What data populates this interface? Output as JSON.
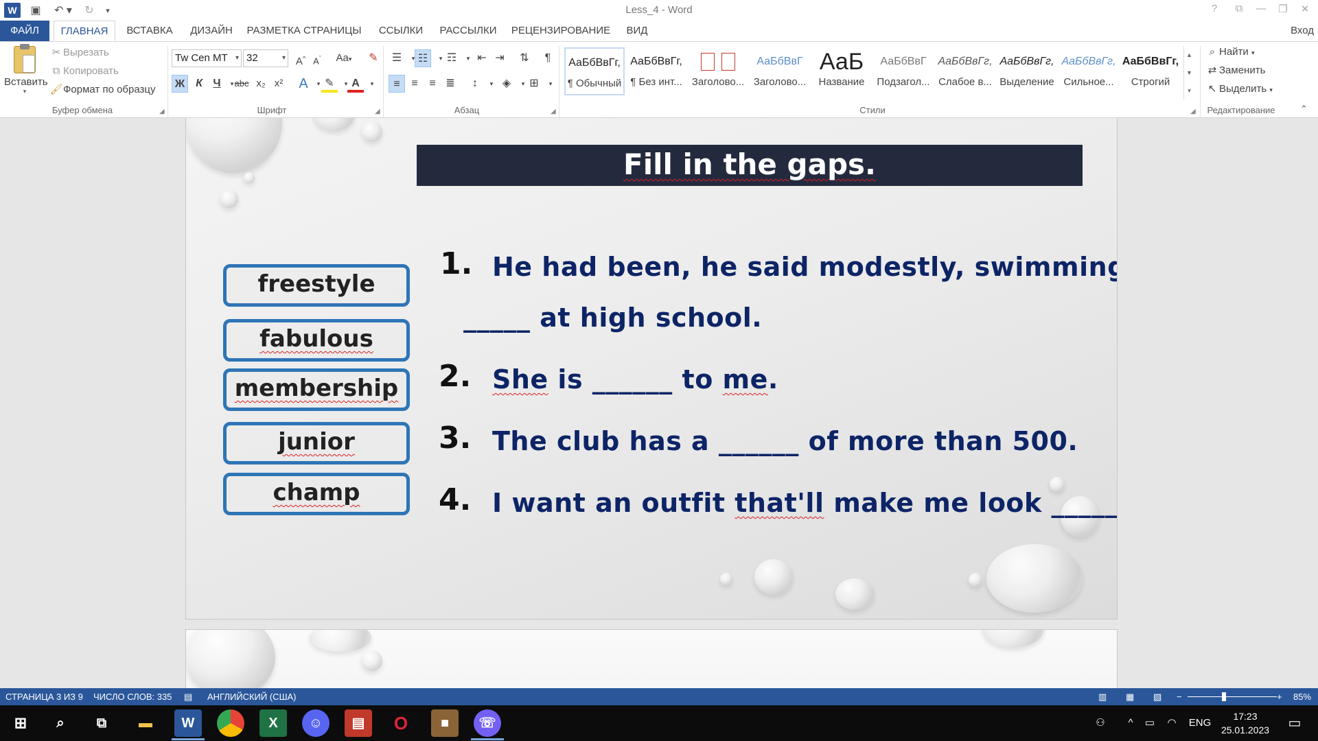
{
  "app": {
    "window_title": "Less_4 - Word",
    "sign_in": "Вход"
  },
  "tabs": [
    {
      "label": "ФАЙЛ"
    },
    {
      "label": "ГЛАВНАЯ"
    },
    {
      "label": "ВСТАВКА"
    },
    {
      "label": "ДИЗАЙН"
    },
    {
      "label": "РАЗМЕТКА СТРАНИЦЫ"
    },
    {
      "label": "ССЫЛКИ"
    },
    {
      "label": "РАССЫЛКИ"
    },
    {
      "label": "РЕЦЕНЗИРОВАНИЕ"
    },
    {
      "label": "ВИД"
    }
  ],
  "ribbon": {
    "clipboard": {
      "paste": "Вставить",
      "cut": "Вырезать",
      "copy": "Копировать",
      "format_painter": "Формат по образцу",
      "group_label": "Буфер обмена"
    },
    "font": {
      "font_name": "Tw Cen MT",
      "font_size": "32",
      "group_label": "Шрифт",
      "bold": "Ж",
      "italic": "К",
      "underline": "Ч",
      "strike": "abc",
      "subscript": "x₂",
      "superscript": "x²",
      "grow": "A",
      "shrink": "A",
      "case": "Aa"
    },
    "paragraph": {
      "group_label": "Абзац"
    },
    "styles": {
      "group_label": "Стили",
      "items": [
        {
          "sample": "АаБбВвГг,",
          "name": "¶ Обычный"
        },
        {
          "sample": "АаБбВвГг,",
          "name": "¶ Без инт..."
        },
        {
          "sample": "",
          "name": "Заголово..."
        },
        {
          "sample": "АаБбВвГ",
          "name": "Заголово..."
        },
        {
          "sample": "АаБ",
          "name": "Название"
        },
        {
          "sample": "АаБбВвГ",
          "name": "Подзагол..."
        },
        {
          "sample": "АаБбВвГг,",
          "name": "Слабое в..."
        },
        {
          "sample": "АаБбВвГг,",
          "name": "Выделение"
        },
        {
          "sample": "АаБбВвГг,",
          "name": "Сильное..."
        },
        {
          "sample": "АаБбВвГг,",
          "name": "Строгий"
        }
      ]
    },
    "editing": {
      "group_label": "Редактирование",
      "find": "Найти",
      "replace": "Заменить",
      "select": "Выделить"
    }
  },
  "document": {
    "heading": "Fill in the gaps.",
    "word_bank": [
      "freestyle",
      "fabulous",
      "membership",
      "junior",
      "champ"
    ],
    "questions": [
      {
        "num": "1.",
        "line1": "He had been, he said modestly, swimming",
        "line2": "_____ at high school."
      },
      {
        "num": "2.",
        "pre": "She",
        "mid": " is ______ to ",
        "post_sq": "me",
        "post": "."
      },
      {
        "num": "3.",
        "text": "The club has a ______ of more than 500."
      },
      {
        "num": "4.",
        "pre": "I want an outfit ",
        "sq": "that'll",
        "post": " make me look ______."
      }
    ]
  },
  "statusbar": {
    "page": "СТРАНИЦА 3 ИЗ 9",
    "words": "ЧИСЛО СЛОВ: 335",
    "language": "АНГЛИЙСКИЙ (США)",
    "zoom": "85%"
  },
  "taskbar": {
    "language": "ENG",
    "time": "17:23",
    "date": "25.01.2023"
  },
  "colors": {
    "accent": "#2b579a",
    "heading_bar": "#242a3e",
    "question_text": "#0d2466",
    "word_box_border": "#2e75b6"
  }
}
